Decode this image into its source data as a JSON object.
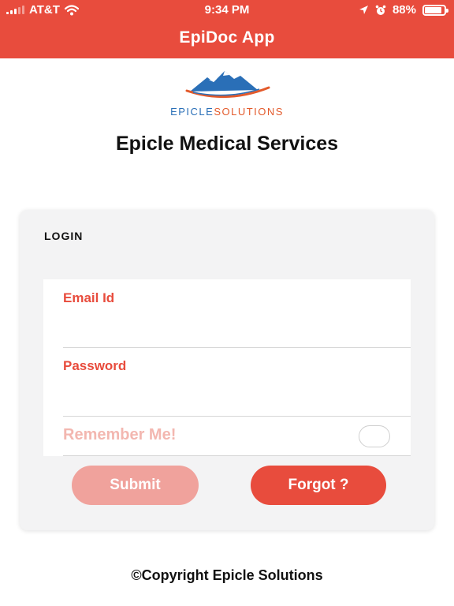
{
  "status_bar": {
    "carrier": "AT&T",
    "time": "9:34 PM",
    "battery": "88%",
    "battery_level": 0.88,
    "icons": [
      "signal-icon",
      "wifi-icon",
      "location-icon",
      "alarm-icon",
      "battery-icon"
    ]
  },
  "header": {
    "title": "EpiDoc App",
    "background": "#e84c3d"
  },
  "logo": {
    "text_part1": "EPICLE",
    "text_part2": "SOLUTIONS"
  },
  "company_title": "Epicle Medical Services",
  "login": {
    "heading": "LOGIN",
    "email_label": "Email Id",
    "email_value": "",
    "password_label": "Password",
    "password_value": "",
    "remember_label": "Remember Me!",
    "remember_checked": false,
    "submit_label": "Submit",
    "forgot_label": "Forgot ?"
  },
  "colors": {
    "accent": "#e84c3d",
    "disabled_button": "#f0a29c",
    "card_background": "#f3f3f4"
  },
  "footer": {
    "copyright": "©Copyright Epicle Solutions"
  }
}
